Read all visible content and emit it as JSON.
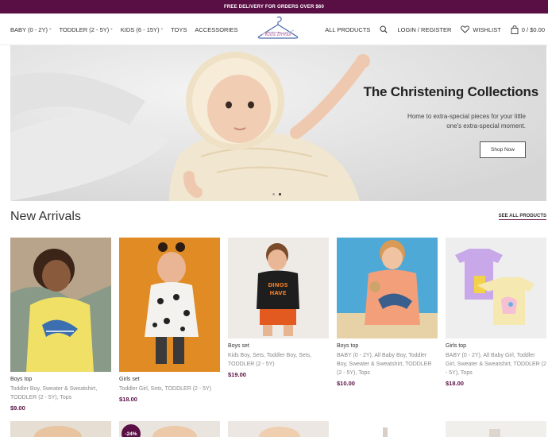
{
  "promo": {
    "text": "FREE DELIVERY FOR ORDERS OVER $60"
  },
  "nav": {
    "left": [
      {
        "label": "BABY (0 - 2Y)",
        "has_dropdown": true
      },
      {
        "label": "TODDLER (2 - 5Y)",
        "has_dropdown": true
      },
      {
        "label": "KIDS (6 - 15Y)",
        "has_dropdown": true
      },
      {
        "label": "TOYS",
        "has_dropdown": false
      },
      {
        "label": "ACCESSORIES",
        "has_dropdown": false
      }
    ],
    "right": {
      "all_products": "ALL PRODUCTS",
      "login": "LOGIN / REGISTER",
      "wishlist": "WISHLIST",
      "cart": "0 / $0.00"
    },
    "logo_text": "Kids Dress"
  },
  "hero": {
    "title": "The Christening Collections",
    "subtitle": "Home to extra-special pieces for your little one's extra-special moment.",
    "button": "Shop Now",
    "slide_count": 2,
    "active_slide": 2
  },
  "arrivals": {
    "title": "New Arrivals",
    "see_all": "SEE ALL PRODUCTS",
    "products": [
      {
        "name": "Boys top",
        "categories": "Toddler Boy, Sweater & Sweatshirt, TODDLER (2 - 5Y), Tops",
        "price": "$9.00"
      },
      {
        "name": "Girls set",
        "categories": "Toddler Girl, Sets, TODDLER (2 - 5Y)",
        "price": "$18.00"
      },
      {
        "name": "Boys set",
        "categories": "Kids Boy, Sets, Toddler Boy, Sets, TODDLER (2 - 5Y)",
        "price": "$19.00"
      },
      {
        "name": "Boys top",
        "categories": "BABY (0 - 2Y), All Baby Boy, Toddler Boy, Sweater & Sweatshirt, TODDLER (2 - 5Y), Tops",
        "price": "$10.00"
      },
      {
        "name": "Girls top",
        "categories": "BABY (0 - 2Y), All Baby Girl, Toddler Girl, Sweater & Sweatshirt, TODDLER (2 - 5Y), Tops",
        "price": "$18.00"
      }
    ],
    "sale_badge": "-24%"
  },
  "colors": {
    "brand": "#5a0f44",
    "price": "#5a0f44"
  }
}
